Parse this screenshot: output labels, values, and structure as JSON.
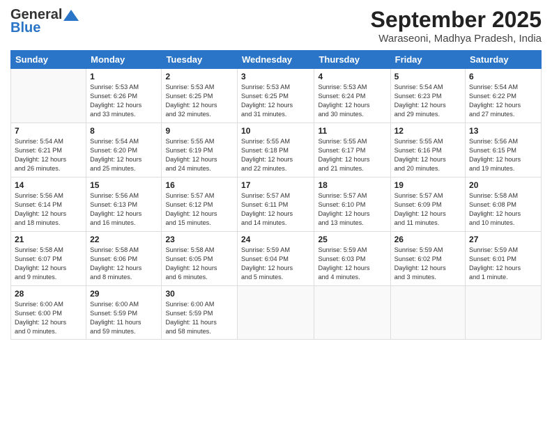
{
  "header": {
    "logo_general": "General",
    "logo_blue": "Blue",
    "title": "September 2025",
    "location": "Waraseoni, Madhya Pradesh, India"
  },
  "days_of_week": [
    "Sunday",
    "Monday",
    "Tuesday",
    "Wednesday",
    "Thursday",
    "Friday",
    "Saturday"
  ],
  "weeks": [
    [
      {
        "day": "",
        "info": ""
      },
      {
        "day": "1",
        "info": "Sunrise: 5:53 AM\nSunset: 6:26 PM\nDaylight: 12 hours\nand 33 minutes."
      },
      {
        "day": "2",
        "info": "Sunrise: 5:53 AM\nSunset: 6:25 PM\nDaylight: 12 hours\nand 32 minutes."
      },
      {
        "day": "3",
        "info": "Sunrise: 5:53 AM\nSunset: 6:25 PM\nDaylight: 12 hours\nand 31 minutes."
      },
      {
        "day": "4",
        "info": "Sunrise: 5:53 AM\nSunset: 6:24 PM\nDaylight: 12 hours\nand 30 minutes."
      },
      {
        "day": "5",
        "info": "Sunrise: 5:54 AM\nSunset: 6:23 PM\nDaylight: 12 hours\nand 29 minutes."
      },
      {
        "day": "6",
        "info": "Sunrise: 5:54 AM\nSunset: 6:22 PM\nDaylight: 12 hours\nand 27 minutes."
      }
    ],
    [
      {
        "day": "7",
        "info": "Sunrise: 5:54 AM\nSunset: 6:21 PM\nDaylight: 12 hours\nand 26 minutes."
      },
      {
        "day": "8",
        "info": "Sunrise: 5:54 AM\nSunset: 6:20 PM\nDaylight: 12 hours\nand 25 minutes."
      },
      {
        "day": "9",
        "info": "Sunrise: 5:55 AM\nSunset: 6:19 PM\nDaylight: 12 hours\nand 24 minutes."
      },
      {
        "day": "10",
        "info": "Sunrise: 5:55 AM\nSunset: 6:18 PM\nDaylight: 12 hours\nand 22 minutes."
      },
      {
        "day": "11",
        "info": "Sunrise: 5:55 AM\nSunset: 6:17 PM\nDaylight: 12 hours\nand 21 minutes."
      },
      {
        "day": "12",
        "info": "Sunrise: 5:55 AM\nSunset: 6:16 PM\nDaylight: 12 hours\nand 20 minutes."
      },
      {
        "day": "13",
        "info": "Sunrise: 5:56 AM\nSunset: 6:15 PM\nDaylight: 12 hours\nand 19 minutes."
      }
    ],
    [
      {
        "day": "14",
        "info": "Sunrise: 5:56 AM\nSunset: 6:14 PM\nDaylight: 12 hours\nand 18 minutes."
      },
      {
        "day": "15",
        "info": "Sunrise: 5:56 AM\nSunset: 6:13 PM\nDaylight: 12 hours\nand 16 minutes."
      },
      {
        "day": "16",
        "info": "Sunrise: 5:57 AM\nSunset: 6:12 PM\nDaylight: 12 hours\nand 15 minutes."
      },
      {
        "day": "17",
        "info": "Sunrise: 5:57 AM\nSunset: 6:11 PM\nDaylight: 12 hours\nand 14 minutes."
      },
      {
        "day": "18",
        "info": "Sunrise: 5:57 AM\nSunset: 6:10 PM\nDaylight: 12 hours\nand 13 minutes."
      },
      {
        "day": "19",
        "info": "Sunrise: 5:57 AM\nSunset: 6:09 PM\nDaylight: 12 hours\nand 11 minutes."
      },
      {
        "day": "20",
        "info": "Sunrise: 5:58 AM\nSunset: 6:08 PM\nDaylight: 12 hours\nand 10 minutes."
      }
    ],
    [
      {
        "day": "21",
        "info": "Sunrise: 5:58 AM\nSunset: 6:07 PM\nDaylight: 12 hours\nand 9 minutes."
      },
      {
        "day": "22",
        "info": "Sunrise: 5:58 AM\nSunset: 6:06 PM\nDaylight: 12 hours\nand 8 minutes."
      },
      {
        "day": "23",
        "info": "Sunrise: 5:58 AM\nSunset: 6:05 PM\nDaylight: 12 hours\nand 6 minutes."
      },
      {
        "day": "24",
        "info": "Sunrise: 5:59 AM\nSunset: 6:04 PM\nDaylight: 12 hours\nand 5 minutes."
      },
      {
        "day": "25",
        "info": "Sunrise: 5:59 AM\nSunset: 6:03 PM\nDaylight: 12 hours\nand 4 minutes."
      },
      {
        "day": "26",
        "info": "Sunrise: 5:59 AM\nSunset: 6:02 PM\nDaylight: 12 hours\nand 3 minutes."
      },
      {
        "day": "27",
        "info": "Sunrise: 5:59 AM\nSunset: 6:01 PM\nDaylight: 12 hours\nand 1 minute."
      }
    ],
    [
      {
        "day": "28",
        "info": "Sunrise: 6:00 AM\nSunset: 6:00 PM\nDaylight: 12 hours\nand 0 minutes."
      },
      {
        "day": "29",
        "info": "Sunrise: 6:00 AM\nSunset: 5:59 PM\nDaylight: 11 hours\nand 59 minutes."
      },
      {
        "day": "30",
        "info": "Sunrise: 6:00 AM\nSunset: 5:59 PM\nDaylight: 11 hours\nand 58 minutes."
      },
      {
        "day": "",
        "info": ""
      },
      {
        "day": "",
        "info": ""
      },
      {
        "day": "",
        "info": ""
      },
      {
        "day": "",
        "info": ""
      }
    ]
  ]
}
